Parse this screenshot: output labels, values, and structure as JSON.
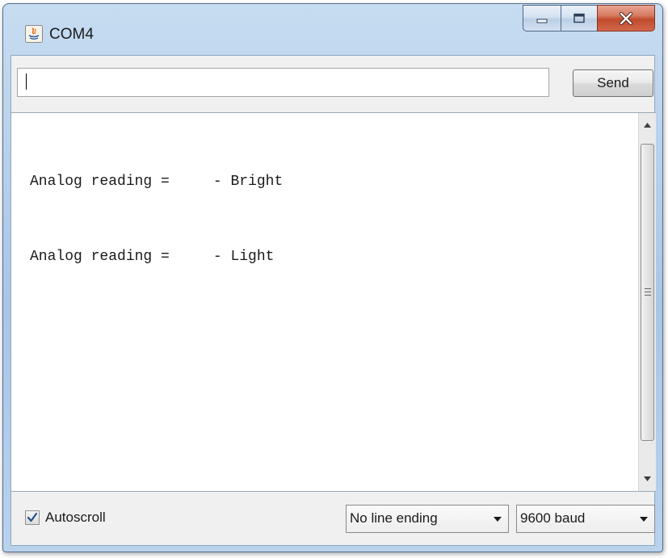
{
  "window": {
    "title": "COM4"
  },
  "input": {
    "value": "",
    "placeholder": ""
  },
  "toolbar": {
    "send_label": "Send"
  },
  "output": {
    "lines": [
      "Analog reading =     - Bright",
      "Analog reading =     - Light"
    ]
  },
  "footer": {
    "autoscroll_label": "Autoscroll",
    "autoscroll_checked": true,
    "line_ending": "No line ending",
    "baud_rate": "9600 baud"
  },
  "icons": {
    "app": "java-icon",
    "minimize": "minimize-icon",
    "maximize": "maximize-icon",
    "close": "close-icon",
    "dropdown": "chevron-down-icon",
    "check": "checkmark-icon"
  },
  "colors": {
    "close_button": "#c04a2c",
    "frame": "#b7d0ea"
  }
}
